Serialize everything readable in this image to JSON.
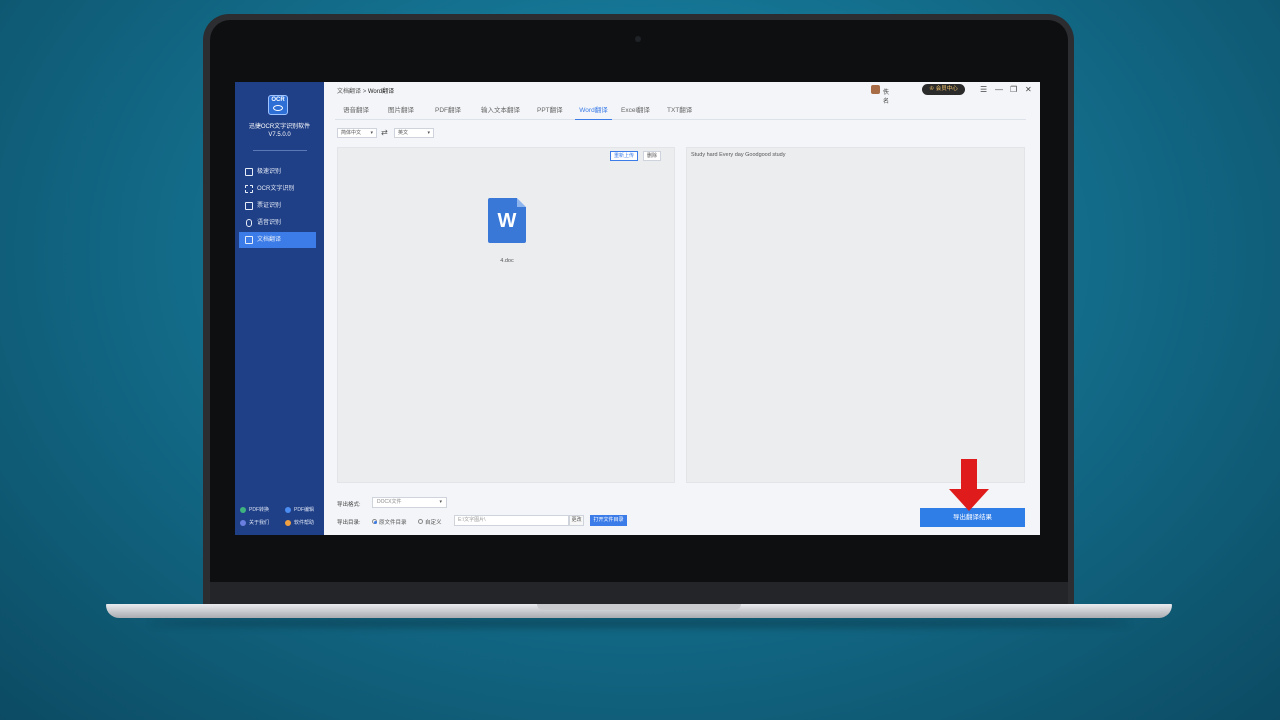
{
  "app": {
    "logo_text": "OCR",
    "name": "迅捷OCR文字识别软件",
    "version": "V7.5.0.0"
  },
  "sidebar": {
    "items": [
      {
        "label": "极速识别"
      },
      {
        "label": "OCR文字识别"
      },
      {
        "label": "票证识别"
      },
      {
        "label": "语音识别"
      },
      {
        "label": "文档翻译",
        "active": true
      }
    ],
    "bottom_links": [
      {
        "label": "PDF转换",
        "color": "#3fb37f"
      },
      {
        "label": "PDF编辑",
        "color": "#4a8cf0"
      },
      {
        "label": "关于我们",
        "color": "#6a7ee0"
      },
      {
        "label": "软件帮助",
        "color": "#f0a040"
      }
    ]
  },
  "header": {
    "breadcrumb_parent": "文档翻译",
    "breadcrumb_sep": ">",
    "breadcrumb_current": "Word翻译",
    "username": "佚名",
    "vip_label": "♔ 会员中心",
    "menu_glyph": "☰",
    "min_glyph": "—",
    "restore_glyph": "❐",
    "close_glyph": "✕"
  },
  "tabs": [
    {
      "label": "语音翻译"
    },
    {
      "label": "图片翻译"
    },
    {
      "label": "PDF翻译"
    },
    {
      "label": "输入文本翻译"
    },
    {
      "label": "PPT翻译"
    },
    {
      "label": "Word翻译",
      "active": true
    },
    {
      "label": "Excel翻译"
    },
    {
      "label": "TXT翻译"
    }
  ],
  "language": {
    "source": "简体中文",
    "target": "英文",
    "swap_glyph": "⇄"
  },
  "left_panel": {
    "reupload_label": "重新上传",
    "delete_label": "删除",
    "file_icon_letter": "W",
    "file_name": "4.doc"
  },
  "right_panel": {
    "result_text": "Study hard Every day Goodgood study"
  },
  "export": {
    "format_label": "导出格式:",
    "format_value": "DOCX文件",
    "dir_label": "导出目录:",
    "radio_source": "原文件目录",
    "radio_custom": "自定义",
    "path_value": "E:\\文字图片\\",
    "change_label": "更改",
    "open_folder_label": "打开文件目录",
    "export_button_label": "导出翻译结果"
  },
  "colors": {
    "sidebar_bg": "#1f3f86",
    "accent": "#3b7ce8",
    "annotation_arrow": "#e01b1b"
  }
}
